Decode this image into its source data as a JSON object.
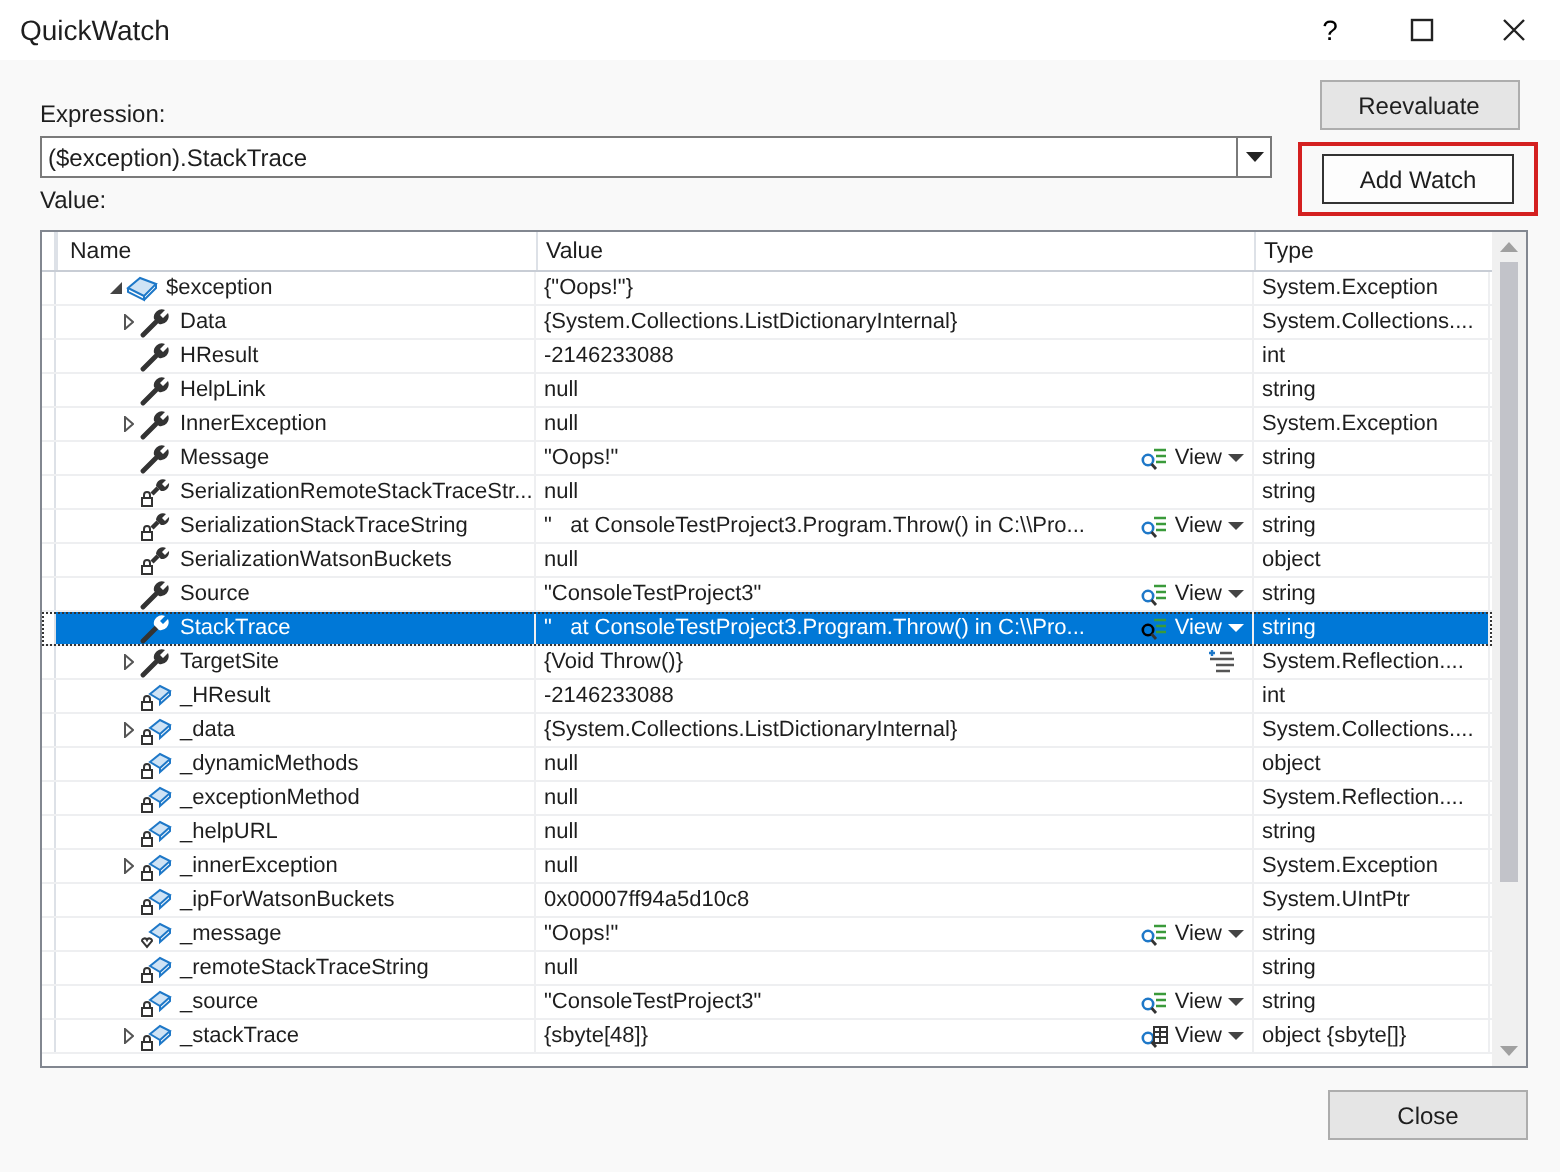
{
  "window": {
    "title": "QuickWatch",
    "controls": [
      "?"
    ]
  },
  "expression": {
    "label": "Expression:",
    "value": "($exception).StackTrace"
  },
  "buttons": {
    "reevaluate": "Reevaluate",
    "add_watch": "Add Watch",
    "add_watch_highlighted": true,
    "close": "Close"
  },
  "value_label": "Value:",
  "table": {
    "columns": [
      "Name",
      "Value",
      "Type"
    ],
    "rows": [
      {
        "kind": "object",
        "name": "$exception",
        "value": "{\"Oops!\"}",
        "type": "System.Exception",
        "expanded": true,
        "selected": false,
        "children": [
          {
            "kind": "property",
            "name": "Data",
            "value": "{System.Collections.ListDictionaryInternal}",
            "type": "System.Collections....",
            "expanded": false,
            "selected": false
          },
          {
            "kind": "property",
            "name": "HResult",
            "value": "-2146233088",
            "type": "int",
            "selected": false
          },
          {
            "kind": "property",
            "name": "HelpLink",
            "value": "null",
            "type": "string",
            "selected": false
          },
          {
            "kind": "property",
            "name": "InnerException",
            "value": "null",
            "type": "System.Exception",
            "expanded": false,
            "selected": false
          },
          {
            "kind": "property",
            "name": "Message",
            "value": "\"Oops!\"",
            "type": "string",
            "view": {
              "kind": "text",
              "label": "View"
            },
            "selected": false
          },
          {
            "kind": "private-property",
            "name": "SerializationRemoteStackTraceStr...",
            "value": "null",
            "type": "string",
            "selected": false
          },
          {
            "kind": "private-property",
            "name": "SerializationStackTraceString",
            "value": "\"   at ConsoleTestProject3.Program.Throw() in C:\\\\Pro...",
            "type": "string",
            "view": {
              "kind": "text",
              "label": "View"
            },
            "selected": false
          },
          {
            "kind": "private-property",
            "name": "SerializationWatsonBuckets",
            "value": "null",
            "type": "object",
            "selected": false
          },
          {
            "kind": "property",
            "name": "Source",
            "value": "\"ConsoleTestProject3\"",
            "type": "string",
            "view": {
              "kind": "text",
              "label": "View"
            },
            "selected": false
          },
          {
            "kind": "property",
            "name": "StackTrace",
            "value": "\"   at ConsoleTestProject3.Program.Throw() in C:\\\\Pro...",
            "type": "string",
            "view": {
              "kind": "text",
              "label": "View"
            },
            "selected": true
          },
          {
            "kind": "property",
            "name": "TargetSite",
            "value": "{Void Throw()}",
            "type": "System.Reflection....",
            "action": {
              "kind": "list"
            },
            "expanded": false,
            "selected": false
          },
          {
            "kind": "private-field",
            "name": "_HResult",
            "value": "-2146233088",
            "type": "int",
            "selected": false
          },
          {
            "kind": "private-field",
            "name": "_data",
            "value": "{System.Collections.ListDictionaryInternal}",
            "type": "System.Collections....",
            "expanded": false,
            "selected": false
          },
          {
            "kind": "private-field",
            "name": "_dynamicMethods",
            "value": "null",
            "type": "object",
            "selected": false
          },
          {
            "kind": "private-field",
            "name": "_exceptionMethod",
            "value": "null",
            "type": "System.Reflection....",
            "selected": false
          },
          {
            "kind": "private-field",
            "name": "_helpURL",
            "value": "null",
            "type": "string",
            "selected": false
          },
          {
            "kind": "private-field",
            "name": "_innerException",
            "value": "null",
            "type": "System.Exception",
            "expanded": false,
            "selected": false
          },
          {
            "kind": "private-field",
            "name": "_ipForWatsonBuckets",
            "value": "0x00007ff94a5d10c8",
            "type": "System.UIntPtr",
            "selected": false
          },
          {
            "kind": "internal-field",
            "name": "_message",
            "value": "\"Oops!\"",
            "type": "string",
            "view": {
              "kind": "text",
              "label": "View"
            },
            "selected": false
          },
          {
            "kind": "private-field",
            "name": "_remoteStackTraceString",
            "value": "null",
            "type": "string",
            "selected": false
          },
          {
            "kind": "private-field",
            "name": "_source",
            "value": "\"ConsoleTestProject3\"",
            "type": "string",
            "view": {
              "kind": "text",
              "label": "View"
            },
            "selected": false
          },
          {
            "kind": "private-field",
            "name": "_stackTrace",
            "value": "{sbyte[48]}",
            "type": "object {sbyte[]}",
            "view": {
              "kind": "table",
              "label": "View"
            },
            "expanded": false,
            "selected": false
          }
        ]
      }
    ]
  }
}
